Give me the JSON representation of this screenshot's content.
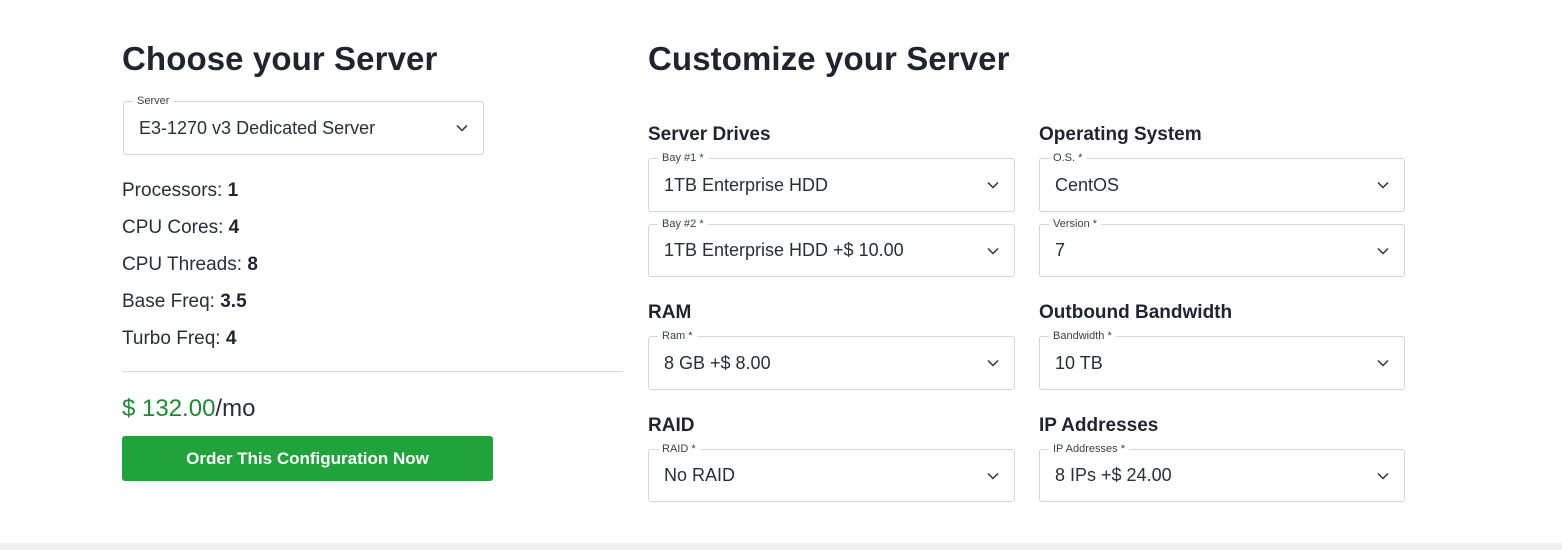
{
  "left": {
    "title": "Choose your Server",
    "server_select": {
      "label": "Server",
      "value": "E3-1270 v3 Dedicated Server"
    },
    "specs": [
      {
        "label": "Processors",
        "value": "1"
      },
      {
        "label": "CPU Cores",
        "value": "4"
      },
      {
        "label": "CPU Threads",
        "value": "8"
      },
      {
        "label": "Base Freq",
        "value": "3.5"
      },
      {
        "label": "Turbo Freq",
        "value": "4"
      }
    ],
    "price": {
      "amount": "$ 132.00",
      "period": "/mo"
    },
    "order_button": "Order This Configuration Now"
  },
  "right": {
    "title": "Customize your Server",
    "server_drives": {
      "heading": "Server Drives",
      "bay1": {
        "label": "Bay #1",
        "value": "1TB Enterprise HDD"
      },
      "bay2": {
        "label": "Bay #2",
        "value": "1TB Enterprise HDD +$ 10.00"
      }
    },
    "operating_system": {
      "heading": "Operating System",
      "os": {
        "label": "O.S.",
        "value": "CentOS"
      },
      "version": {
        "label": "Version",
        "value": "7"
      }
    },
    "ram": {
      "heading": "RAM",
      "select": {
        "label": "Ram",
        "value": "8 GB +$ 8.00"
      }
    },
    "bandwidth": {
      "heading": "Outbound Bandwidth",
      "select": {
        "label": "Bandwidth",
        "value": "10 TB"
      }
    },
    "raid": {
      "heading": "RAID",
      "select": {
        "label": "RAID",
        "value": "No RAID"
      }
    },
    "ip_addresses": {
      "heading": "IP Addresses",
      "select": {
        "label": "IP Addresses",
        "value": "8 IPs +$ 24.00"
      }
    }
  },
  "required_marker": "*",
  "colors": {
    "price_green": "#1e8a34",
    "button_green": "#20a33a",
    "text_dark": "#1f2430",
    "border": "#d6d6d6"
  }
}
